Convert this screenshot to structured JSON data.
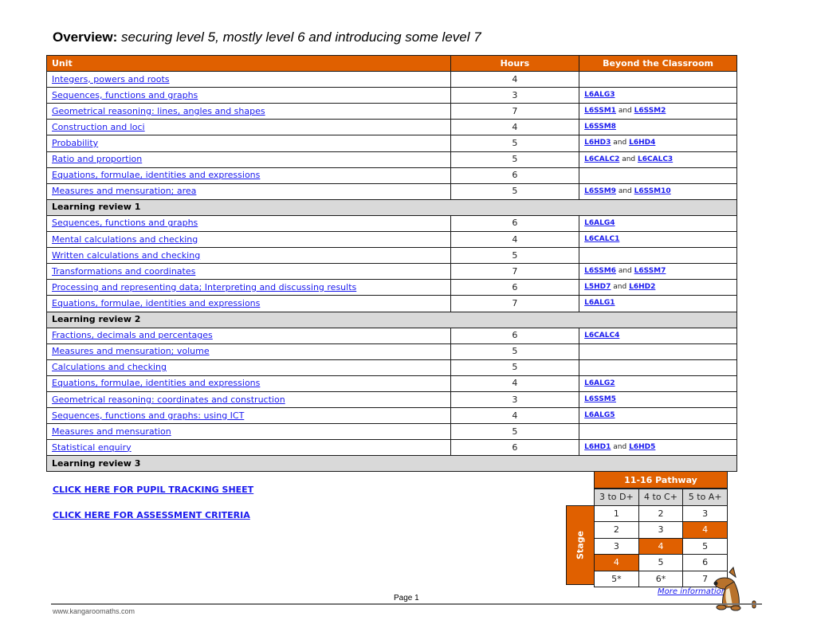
{
  "title": {
    "bold": "Overview:",
    "italic": "securing level 5, mostly level 6 and introducing some level 7"
  },
  "table": {
    "headers": {
      "unit": "Unit",
      "hours": "Hours",
      "beyond": "Beyond the Classroom"
    },
    "rows": [
      {
        "type": "unit",
        "unit": "Integers, powers and roots",
        "hours": "4",
        "links": []
      },
      {
        "type": "unit",
        "unit": "Sequences, functions and graphs",
        "hours": "3",
        "links": [
          "L6ALG3"
        ]
      },
      {
        "type": "unit",
        "unit": "Geometrical reasoning: lines, angles and shapes",
        "hours": "7",
        "links": [
          "L6SSM1",
          "L6SSM2"
        ]
      },
      {
        "type": "unit",
        "unit": "Construction and loci",
        "hours": "4",
        "links": [
          "L6SSM8"
        ]
      },
      {
        "type": "unit",
        "unit": "Probability",
        "hours": "5",
        "links": [
          "L6HD3",
          "L6HD4"
        ]
      },
      {
        "type": "unit",
        "unit": "Ratio and proportion",
        "hours": "5",
        "links": [
          "L6CALC2",
          "L6CALC3"
        ]
      },
      {
        "type": "unit",
        "unit": "Equations, formulae, identities and expressions",
        "hours": "6",
        "links": []
      },
      {
        "type": "unit",
        "unit": "Measures and mensuration; area",
        "hours": "5",
        "links": [
          "L6SSM9",
          "L6SSM10"
        ]
      },
      {
        "type": "review",
        "unit": "Learning review 1"
      },
      {
        "type": "unit",
        "unit": "Sequences, functions and graphs",
        "hours": "6",
        "links": [
          "L6ALG4"
        ]
      },
      {
        "type": "unit",
        "unit": "Mental calculations and checking",
        "hours": "4",
        "links": [
          "L6CALC1"
        ]
      },
      {
        "type": "unit",
        "unit": "Written calculations and checking",
        "hours": "5",
        "links": []
      },
      {
        "type": "unit",
        "unit": "Transformations and coordinates",
        "hours": "7",
        "links": [
          "L6SSM6",
          "L6SSM7"
        ]
      },
      {
        "type": "unit",
        "unit": "Processing and representing data; Interpreting and discussing results",
        "hours": "6",
        "links": [
          "L5HD7",
          "L6HD2"
        ]
      },
      {
        "type": "unit",
        "unit": "Equations, formulae, identities and expressions",
        "hours": "7",
        "links": [
          "L6ALG1"
        ]
      },
      {
        "type": "review",
        "unit": "Learning review 2"
      },
      {
        "type": "unit",
        "unit": "Fractions, decimals and percentages",
        "hours": "6",
        "links": [
          "L6CALC4"
        ]
      },
      {
        "type": "unit",
        "unit": "Measures and mensuration; volume",
        "hours": "5",
        "links": []
      },
      {
        "type": "unit",
        "unit": "Calculations and checking",
        "hours": "5",
        "links": []
      },
      {
        "type": "unit",
        "unit": "Equations, formulae, identities and expressions",
        "hours": "4",
        "links": [
          "L6ALG2"
        ]
      },
      {
        "type": "unit",
        "unit": "Geometrical reasoning: coordinates and construction",
        "hours": "3",
        "links": [
          "L6SSM5"
        ]
      },
      {
        "type": "unit",
        "unit": "Sequences, functions and graphs: using ICT",
        "hours": "4",
        "links": [
          "L6ALG5"
        ]
      },
      {
        "type": "unit",
        "unit": "Measures and mensuration",
        "hours": "5",
        "links": []
      },
      {
        "type": "unit",
        "unit": "Statistical enquiry",
        "hours": "6",
        "links": [
          "L6HD1",
          "L6HD5"
        ]
      },
      {
        "type": "review",
        "unit": "Learning review 3"
      }
    ],
    "link_joiner": "and"
  },
  "links": {
    "tracking": "CLICK HERE FOR PUPIL TRACKING SHEET",
    "assessment": "CLICK HERE FOR ASSESSMENT CRITERIA"
  },
  "pathway": {
    "title": "11-16 Pathway",
    "side_label": "Stage",
    "columns": [
      "3 to D+",
      "4 to C+",
      "5 to A+"
    ],
    "rows": [
      [
        "1",
        "2",
        "3"
      ],
      [
        "2",
        "3",
        "4"
      ],
      [
        "3",
        "4",
        "5"
      ],
      [
        "4",
        "5",
        "6"
      ],
      [
        "5*",
        "6*",
        "7"
      ]
    ],
    "highlighted": [
      [
        1,
        2
      ],
      [
        2,
        1
      ],
      [
        3,
        0
      ]
    ],
    "accent": "#e06000",
    "more_info": "More information"
  },
  "footer": {
    "page": "Page 1",
    "site": "www.kangaroomaths.com"
  }
}
